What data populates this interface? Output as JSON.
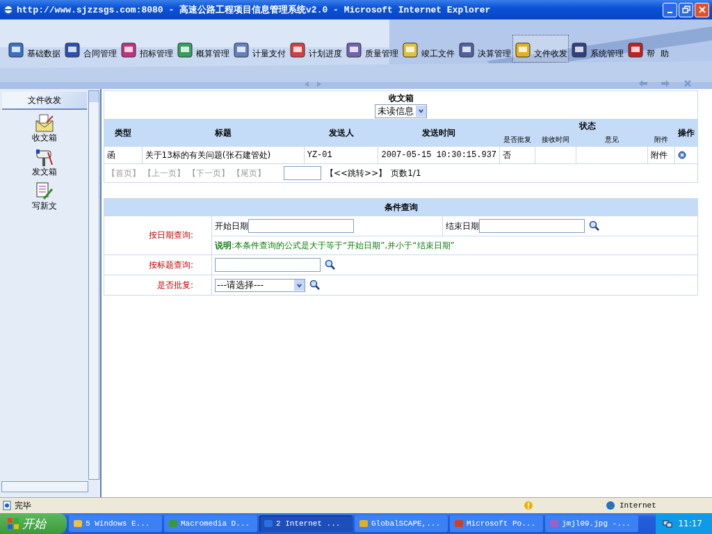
{
  "window": {
    "title": "http://www.sjzzsgs.com:8080 - 高速公路工程项目信息管理系统v2.0 - Microsoft Internet Explorer"
  },
  "nav": [
    {
      "label": "基础数据",
      "selected": false
    },
    {
      "label": "合同管理",
      "selected": false
    },
    {
      "label": "招标管理",
      "selected": false
    },
    {
      "label": "概算管理",
      "selected": false
    },
    {
      "label": "计量支付",
      "selected": false
    },
    {
      "label": "计划进度",
      "selected": false
    },
    {
      "label": "质量管理",
      "selected": false
    },
    {
      "label": "竣工文件",
      "selected": false
    },
    {
      "label": "决算管理",
      "selected": false
    },
    {
      "label": "文件收发",
      "selected": true
    },
    {
      "label": "系统管理",
      "selected": false
    },
    {
      "label": "帮  助",
      "selected": false
    }
  ],
  "sidebar": {
    "title": "文件收发",
    "items": [
      {
        "label": "收文箱"
      },
      {
        "label": "发文箱"
      },
      {
        "label": "写新文"
      }
    ]
  },
  "inbox": {
    "title": "收文箱",
    "filter": "未读信息",
    "columns": {
      "type": "类型",
      "title": "标题",
      "sender": "发送人",
      "time": "发送时间",
      "status": "状态",
      "status_sub": [
        "是否批复",
        "接收时间",
        "意见",
        "附件"
      ],
      "action": "操作"
    },
    "rows": [
      {
        "type": "函",
        "title": "关于13标的有关问题(张石建管处)",
        "sender": "YZ-01",
        "time": "2007-05-15 10:30:15.937",
        "replied": "否",
        "attachment": "附件"
      }
    ],
    "pager": {
      "links": [
        {
          "label": "【首页】",
          "disabled": true
        },
        {
          "label": "【上一页】",
          "disabled": true
        },
        {
          "label": "【下一页】",
          "disabled": true
        },
        {
          "label": "【尾页】",
          "disabled": true
        }
      ],
      "jump": "【<<跳转>>】",
      "pages": "页数1/1"
    }
  },
  "query": {
    "title": "条件查询",
    "date_label": "按日期查询:",
    "start_label": "开始日期",
    "end_label": "结束日期",
    "note_bold": "说明",
    "note": ":本条件查询的公式是大于等于“开始日期”,并小于“结束日期”",
    "title_label": "按标题查询:",
    "reply_label": "是否批复:",
    "reply_select": "---请选择---"
  },
  "status_bar": {
    "text": "完毕",
    "zone": "Internet"
  },
  "taskbar": {
    "start": "开始",
    "tasks": [
      {
        "label": "5 Windows E...",
        "selected": false
      },
      {
        "label": "Macromedia D...",
        "selected": false
      },
      {
        "label": "2 Internet ...",
        "selected": true
      },
      {
        "label": "GlobalSCAPE,...",
        "selected": false
      },
      {
        "label": "Microsoft Po...",
        "selected": false
      },
      {
        "label": "jmjl09.jpg -...",
        "selected": false
      }
    ],
    "clock": "11:17"
  }
}
